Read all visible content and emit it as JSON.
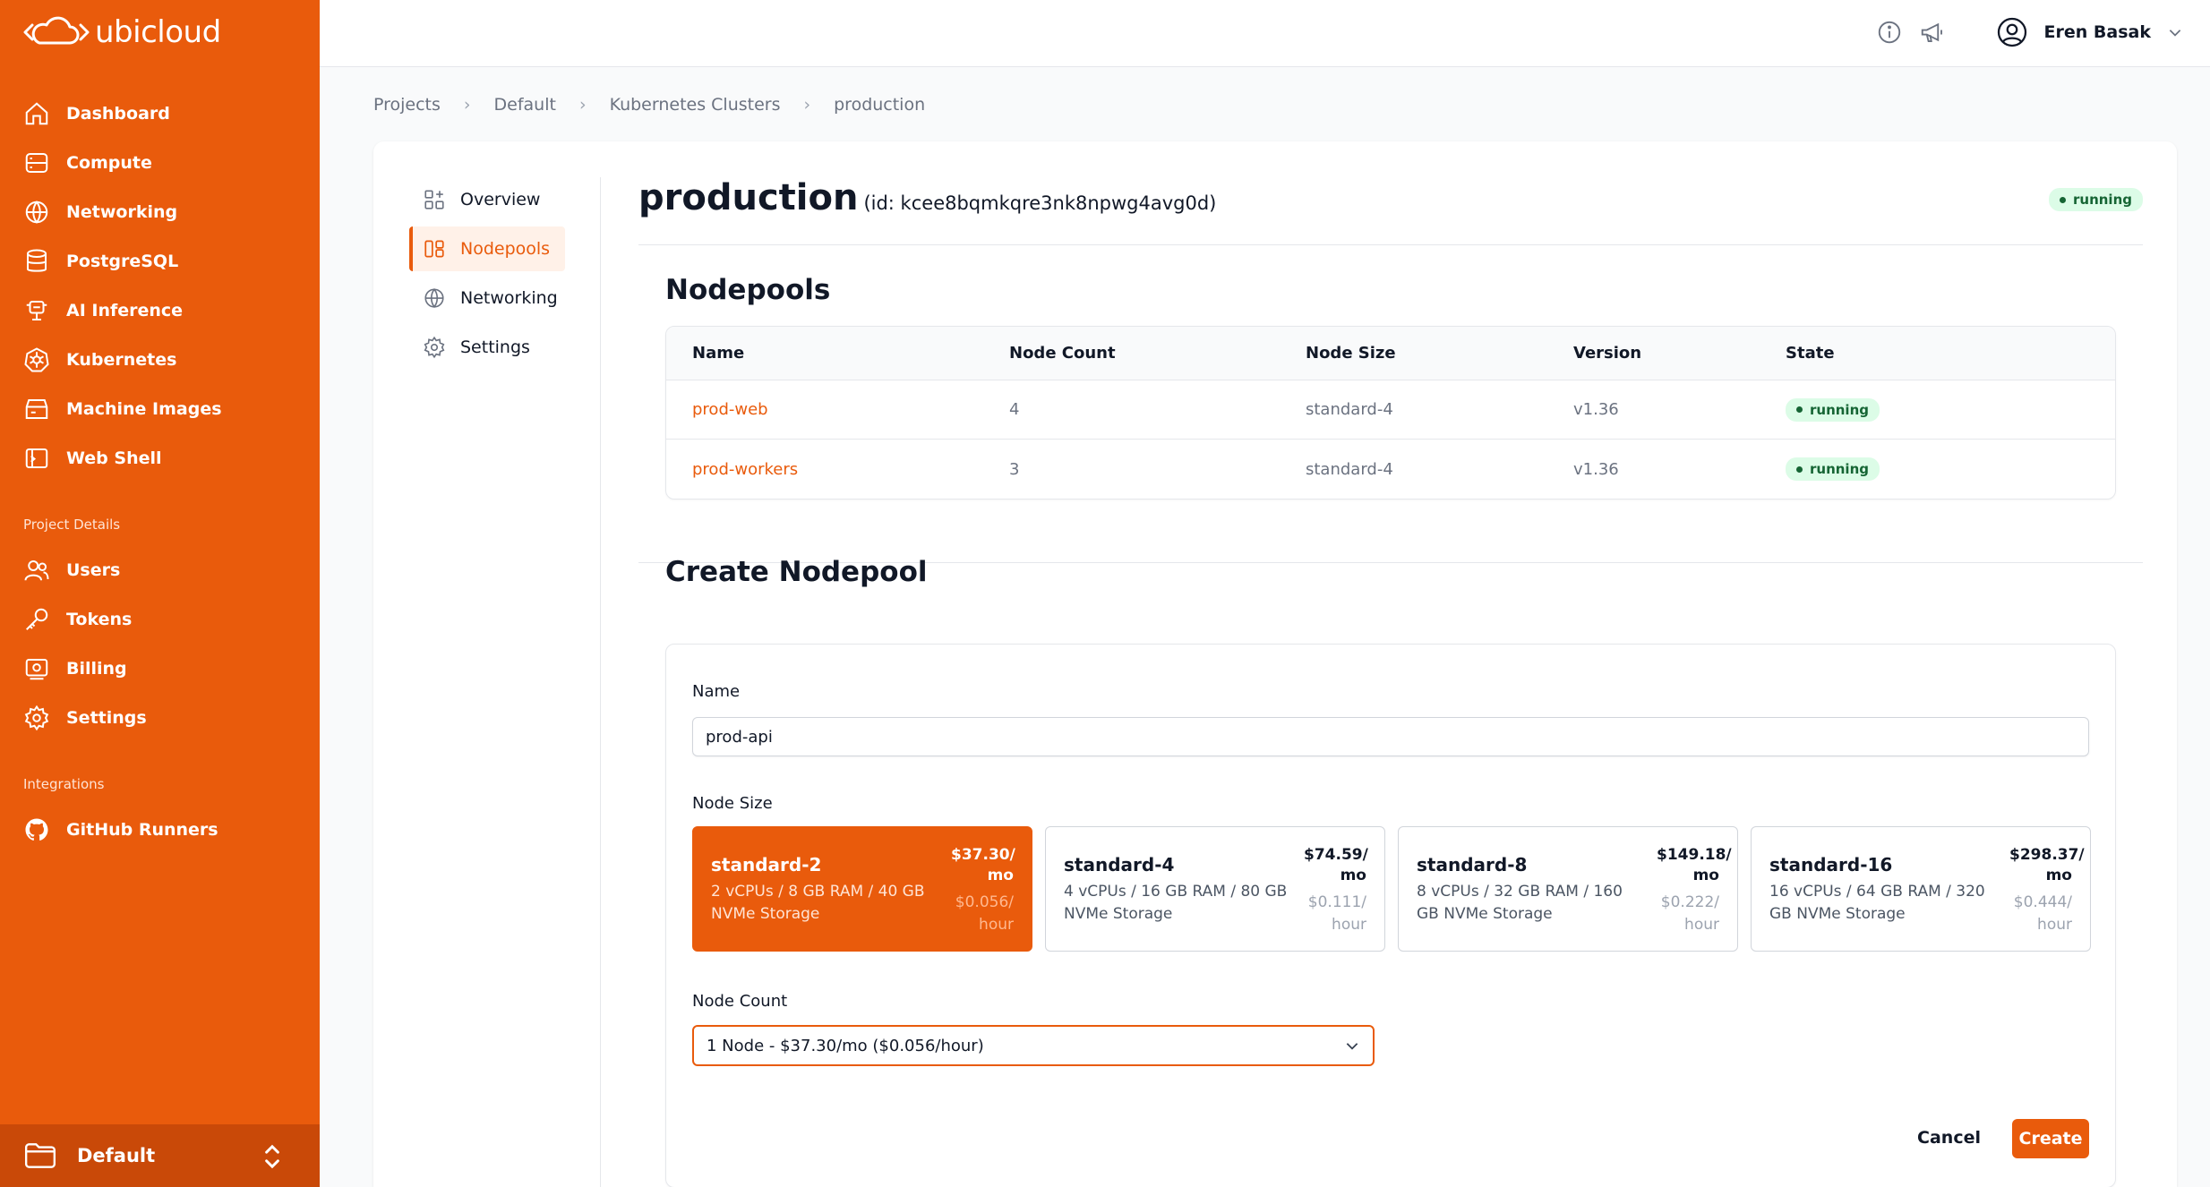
{
  "app": {
    "logo_text": "ubicloud",
    "brand_color": "#e95b0c"
  },
  "sidebar": {
    "items": [
      {
        "label": "Dashboard",
        "icon": "home-icon"
      },
      {
        "label": "Compute",
        "icon": "server-icon"
      },
      {
        "label": "Networking",
        "icon": "globe-icon"
      },
      {
        "label": "PostgreSQL",
        "icon": "database-icon"
      },
      {
        "label": "AI Inference",
        "icon": "ai-chip-icon"
      },
      {
        "label": "Kubernetes",
        "icon": "kubernetes-icon"
      },
      {
        "label": "Machine Images",
        "icon": "machine-image-icon"
      },
      {
        "label": "Web Shell",
        "icon": "terminal-icon"
      }
    ],
    "project_section_title": "Project Details",
    "project_items": [
      {
        "label": "Users",
        "icon": "users-icon"
      },
      {
        "label": "Tokens",
        "icon": "key-icon"
      },
      {
        "label": "Billing",
        "icon": "billing-icon"
      },
      {
        "label": "Settings",
        "icon": "gear-icon"
      }
    ],
    "integrations_section_title": "Integrations",
    "integration_items": [
      {
        "label": "GitHub Runners",
        "icon": "github-icon"
      }
    ],
    "project_switcher": {
      "label": "Default"
    }
  },
  "header": {
    "user_name": "Eren Basak"
  },
  "breadcrumb": [
    "Projects",
    "Default",
    "Kubernetes Clusters",
    "production"
  ],
  "subnav": [
    {
      "label": "Overview",
      "icon": "overview-icon"
    },
    {
      "label": "Nodepools",
      "icon": "nodepools-icon",
      "active": true
    },
    {
      "label": "Networking",
      "icon": "globe-icon"
    },
    {
      "label": "Settings",
      "icon": "gear-icon"
    }
  ],
  "cluster": {
    "name": "production",
    "id_text": "(id: kcee8bqmkqre3nk8npwg4avg0d)",
    "status": "running"
  },
  "nodepools": {
    "title": "Nodepools",
    "columns": [
      "Name",
      "Node Count",
      "Node Size",
      "Version",
      "State"
    ],
    "rows": [
      {
        "name": "prod-web",
        "node_count": "4",
        "node_size": "standard-4",
        "version": "v1.36",
        "state": "running"
      },
      {
        "name": "prod-workers",
        "node_count": "3",
        "node_size": "standard-4",
        "version": "v1.36",
        "state": "running"
      }
    ]
  },
  "create": {
    "title": "Create Nodepool",
    "name_label": "Name",
    "name_value": "prod-api",
    "size_label": "Node Size",
    "sizes": [
      {
        "name": "standard-2",
        "spec": "2 vCPUs / 8 GB RAM / 40 GB NVMe Storage",
        "price": "$37.30/ mo",
        "hourly": "$0.056/ hour",
        "selected": true
      },
      {
        "name": "standard-4",
        "spec": "4 vCPUs / 16 GB RAM / 80 GB NVMe Storage",
        "price": "$74.59/ mo",
        "hourly": "$0.111/ hour",
        "selected": false
      },
      {
        "name": "standard-8",
        "spec": "8 vCPUs / 32 GB RAM / 160 GB NVMe Storage",
        "price": "$149.18/ mo",
        "hourly": "$0.222/ hour",
        "selected": false
      },
      {
        "name": "standard-16",
        "spec": "16 vCPUs / 64 GB RAM / 320 GB NVMe Storage",
        "price": "$298.37/ mo",
        "hourly": "$0.444/ hour",
        "selected": false
      }
    ],
    "count_label": "Node Count",
    "count_value": "1 Node - $37.30/mo ($0.056/hour)",
    "cancel_label": "Cancel",
    "create_label": "Create"
  }
}
